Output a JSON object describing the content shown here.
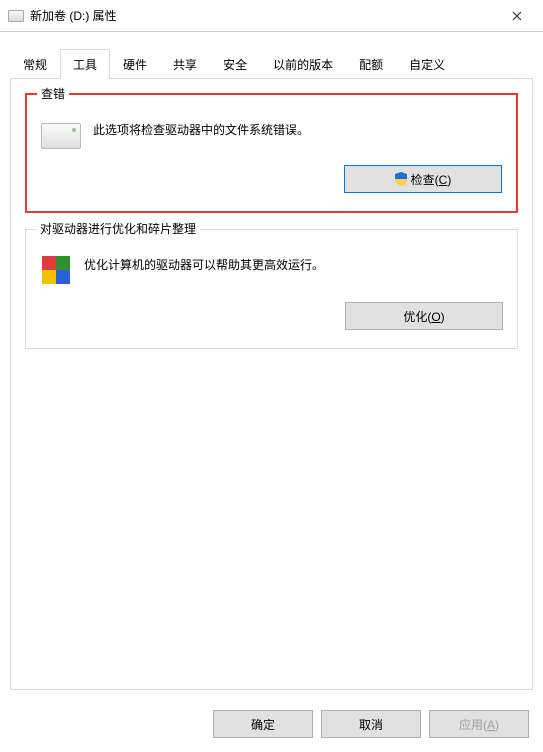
{
  "window": {
    "title": "新加卷 (D:) 属性"
  },
  "tabs": [
    {
      "label": "常规"
    },
    {
      "label": "工具"
    },
    {
      "label": "硬件"
    },
    {
      "label": "共享"
    },
    {
      "label": "安全"
    },
    {
      "label": "以前的版本"
    },
    {
      "label": "配额"
    },
    {
      "label": "自定义"
    }
  ],
  "active_tab_index": 1,
  "sections": {
    "check": {
      "legend": "查错",
      "description": "此选项将检查驱动器中的文件系统错误。",
      "button_prefix": "检查(",
      "button_key": "C",
      "button_suffix": ")"
    },
    "optimize": {
      "legend": "对驱动器进行优化和碎片整理",
      "description": "优化计算机的驱动器可以帮助其更高效运行。",
      "button_prefix": "优化(",
      "button_key": "O",
      "button_suffix": ")"
    }
  },
  "buttons": {
    "ok": "确定",
    "cancel": "取消",
    "apply_prefix": "应用(",
    "apply_key": "A",
    "apply_suffix": ")"
  }
}
